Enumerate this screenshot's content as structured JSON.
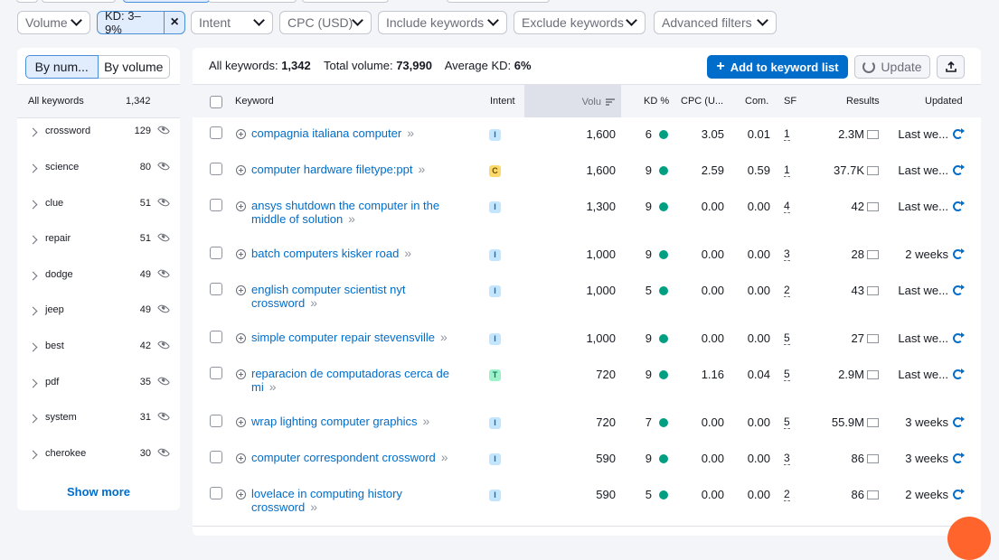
{
  "filters": {
    "volume": "Volume",
    "kd": "KD: 3–9%",
    "kd_clear": "×",
    "intent": "Intent",
    "cpc": "CPC (USD)",
    "include": "Include keywords",
    "exclude": "Exclude keywords",
    "advanced": "Advanced filters"
  },
  "sidebar": {
    "toggle": {
      "by_number": "By num...",
      "by_volume": "By volume",
      "selected": "by_number"
    },
    "header": {
      "label": "All keywords",
      "count": "1,342"
    },
    "groups": [
      {
        "label": "crossword",
        "count": "129"
      },
      {
        "label": "science",
        "count": "80"
      },
      {
        "label": "clue",
        "count": "51"
      },
      {
        "label": "repair",
        "count": "51"
      },
      {
        "label": "dodge",
        "count": "49"
      },
      {
        "label": "jeep",
        "count": "49"
      },
      {
        "label": "best",
        "count": "42"
      },
      {
        "label": "pdf",
        "count": "35"
      },
      {
        "label": "system",
        "count": "31"
      },
      {
        "label": "cherokee",
        "count": "30"
      }
    ],
    "show_more": "Show more"
  },
  "summary": {
    "all_keywords_label": "All keywords:",
    "all_keywords_value": "1,342",
    "total_volume_label": "Total volume:",
    "total_volume_value": "73,990",
    "avg_kd_label": "Average KD:",
    "avg_kd_value": "6%"
  },
  "actions": {
    "add": "Add to keyword list",
    "add_icon": "plus-icon",
    "update": "Update",
    "update_icon": "refresh-icon",
    "export_icon": "export-icon"
  },
  "columns": {
    "keyword": "Keyword",
    "intent": "Intent",
    "volume": "Volu",
    "kd": "KD %",
    "cpc": "CPC (U...",
    "com": "Com.",
    "sf": "SF",
    "results": "Results",
    "updated": "Updated"
  },
  "colors": {
    "accent": "#006dca",
    "kd_easy": "#009f81",
    "intent_informational": "#c4e5fe",
    "intent_commercial": "#fcd96b",
    "intent_transactional": "#9ef2c9"
  },
  "rows": [
    {
      "keyword": "compagnia italiana computer",
      "intent": "I",
      "volume": "1,600",
      "kd": "6",
      "cpc": "3.05",
      "com": "0.01",
      "sf": "1",
      "results": "2.3M",
      "updated": "Last we..."
    },
    {
      "keyword": "computer hardware filetype:ppt",
      "intent": "C",
      "volume": "1,600",
      "kd": "9",
      "cpc": "2.59",
      "com": "0.59",
      "sf": "1",
      "results": "37.7K",
      "updated": "Last we..."
    },
    {
      "keyword": "ansys shutdown the computer in the middle of solution",
      "intent": "I",
      "volume": "1,300",
      "kd": "9",
      "cpc": "0.00",
      "com": "0.00",
      "sf": "4",
      "results": "42",
      "updated": "Last we..."
    },
    {
      "keyword": "batch computers kisker road",
      "intent": "I",
      "volume": "1,000",
      "kd": "9",
      "cpc": "0.00",
      "com": "0.00",
      "sf": "3",
      "results": "28",
      "updated": "2 weeks"
    },
    {
      "keyword": "english computer scientist nyt crossword",
      "intent": "I",
      "volume": "1,000",
      "kd": "5",
      "cpc": "0.00",
      "com": "0.00",
      "sf": "2",
      "results": "43",
      "updated": "Last we..."
    },
    {
      "keyword": "simple computer repair stevensville",
      "intent": "I",
      "volume": "1,000",
      "kd": "9",
      "cpc": "0.00",
      "com": "0.00",
      "sf": "5",
      "results": "27",
      "updated": "Last we..."
    },
    {
      "keyword": "reparacion de computadoras cerca de mi",
      "intent": "T",
      "volume": "720",
      "kd": "9",
      "cpc": "1.16",
      "com": "0.04",
      "sf": "5",
      "results": "2.9M",
      "updated": "Last we..."
    },
    {
      "keyword": "wrap lighting computer graphics",
      "intent": "I",
      "volume": "720",
      "kd": "7",
      "cpc": "0.00",
      "com": "0.00",
      "sf": "5",
      "results": "55.9M",
      "updated": "3 weeks"
    },
    {
      "keyword": "computer correspondent crossword",
      "intent": "I",
      "volume": "590",
      "kd": "9",
      "cpc": "0.00",
      "com": "0.00",
      "sf": "3",
      "results": "86",
      "updated": "3 weeks"
    },
    {
      "keyword": "lovelace in computing history crossword",
      "intent": "I",
      "volume": "590",
      "kd": "5",
      "cpc": "0.00",
      "com": "0.00",
      "sf": "2",
      "results": "86",
      "updated": "2 weeks"
    }
  ]
}
